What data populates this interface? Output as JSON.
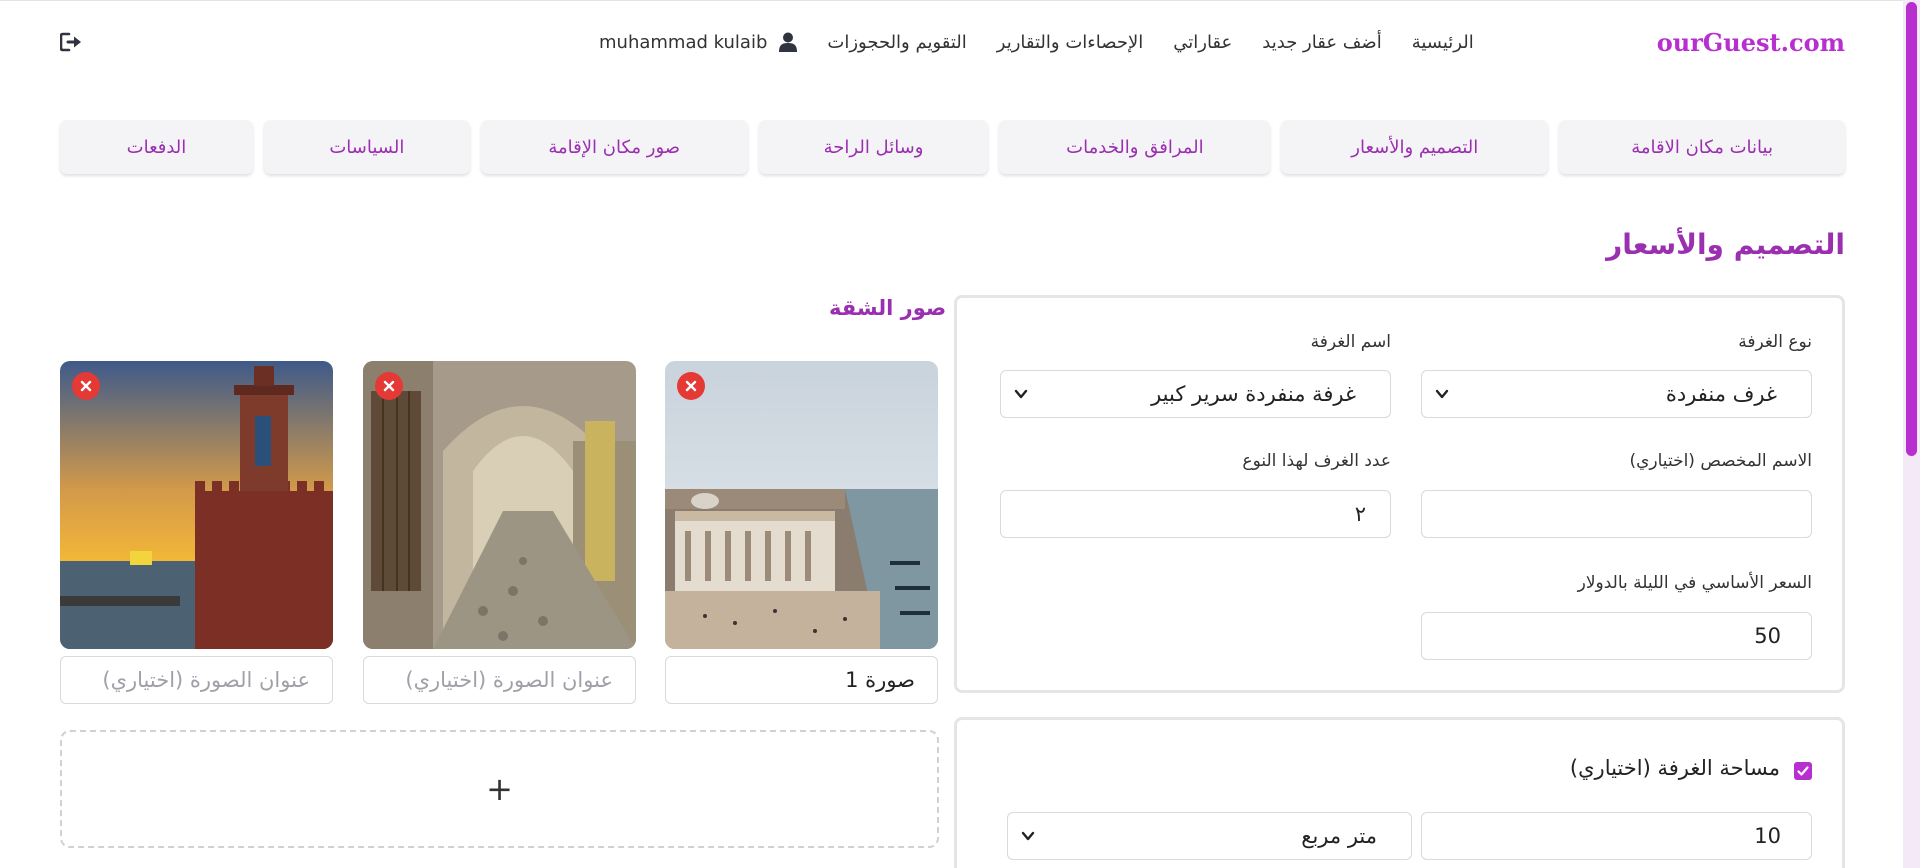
{
  "header": {
    "brand": "ourGuest.com",
    "nav": [
      {
        "label": "الرئيسية"
      },
      {
        "label": "أضف عقار جديد"
      },
      {
        "label": "عقاراتي"
      },
      {
        "label": "الإحصاءات والتقارير"
      },
      {
        "label": "التقويم والحجوزات"
      }
    ],
    "user_name": "muhammad kulaib",
    "user_icon": "user-icon",
    "logout_icon": "logout-icon"
  },
  "tabs": [
    {
      "label": "بيانات مكان الاقامة"
    },
    {
      "label": "التصميم والأسعار"
    },
    {
      "label": "المرافق والخدمات"
    },
    {
      "label": "وسائل الراحة"
    },
    {
      "label": "صور مكان الإقامة"
    },
    {
      "label": "السياسات"
    },
    {
      "label": "الدفعات"
    }
  ],
  "section_title": "التصميم والأسعار",
  "form": {
    "room_type_label": "نوع الغرفة",
    "room_type_value": "غرف منفردة",
    "room_name_label": "اسم الغرفة",
    "room_name_value": "غرفة منفردة سرير كبير",
    "custom_name_label": "الاسم المخصص (اختياري)",
    "custom_name_value": "",
    "room_count_label": "عدد الغرف لهذا النوع",
    "room_count_value": "٢",
    "base_price_label": "السعر الأساسي في الليلة بالدولار",
    "base_price_value": "50",
    "room_area_label": "مساحة الغرفة (اختياري)",
    "room_area_checked": true,
    "room_area_value": "10",
    "room_area_unit": "متر مربع"
  },
  "photos": {
    "title": "صور الشقة",
    "caption_placeholder": "عنوان الصورة (اختياري)",
    "items": [
      {
        "caption": "صورة 1",
        "subject": "aerial city square by the sea"
      },
      {
        "caption": "",
        "subject": "stone alley with arch"
      },
      {
        "caption": "",
        "subject": "minaret at sunset by the sea"
      }
    ],
    "add_label": "+"
  },
  "colors": {
    "accent": "#b82fd0",
    "accent_dark": "#9a2fb0",
    "remove": "#e53935"
  }
}
